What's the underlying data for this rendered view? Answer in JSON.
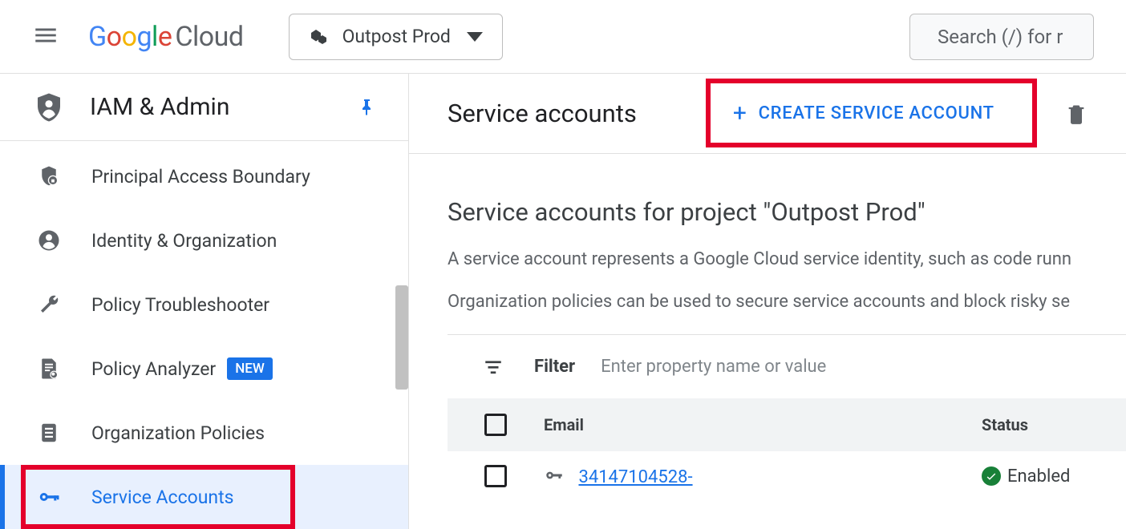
{
  "topbar": {
    "logo_suffix": "Cloud",
    "project_name": "Outpost Prod",
    "search_placeholder": "Search (/) for r"
  },
  "sidebar": {
    "section_title": "IAM & Admin",
    "items": [
      {
        "label": "Principal Access Boundary"
      },
      {
        "label": "Identity & Organization"
      },
      {
        "label": "Policy Troubleshooter"
      },
      {
        "label": "Policy Analyzer",
        "badge": "NEW"
      },
      {
        "label": "Organization Policies"
      },
      {
        "label": "Service Accounts",
        "active": true
      }
    ]
  },
  "main": {
    "page_title": "Service accounts",
    "create_label": "CREATE SERVICE ACCOUNT",
    "heading": "Service accounts for project \"Outpost Prod\"",
    "desc1": "A service account represents a Google Cloud service identity, such as code runn",
    "desc2": "Organization policies can be used to secure service accounts and block risky se",
    "filter_label": "Filter",
    "filter_placeholder": "Enter property name or value",
    "table": {
      "cols": {
        "email": "Email",
        "status": "Status"
      },
      "rows": [
        {
          "email_text": "34147104528-",
          "status_text": "Enabled"
        }
      ]
    }
  }
}
